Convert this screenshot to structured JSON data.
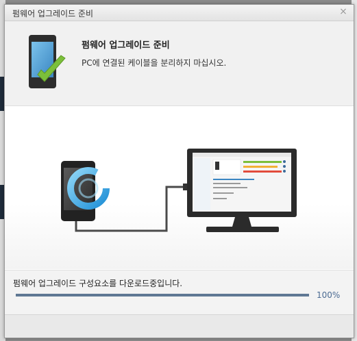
{
  "dialog": {
    "title": "펌웨어 업그레이드 준비",
    "close_glyph": "×"
  },
  "header": {
    "title": "펌웨어 업그레이드 준비",
    "subtitle": "PC에 연결된 케이블을 분리하지 마십시오.",
    "icon": "phone-check-icon"
  },
  "illustration": {
    "phone_icon": "phone-icon",
    "sync_icon": "sync-ring-icon",
    "monitor_icon": "monitor-icon",
    "accent_color": "#3aa9e6",
    "check_color": "#7bbf3a"
  },
  "progress": {
    "status": "펌웨어 업그레이드 구성요소를 다운로드중입니다.",
    "percent_label": "100%",
    "value": 1.0,
    "fill_color": "#5f7894"
  }
}
